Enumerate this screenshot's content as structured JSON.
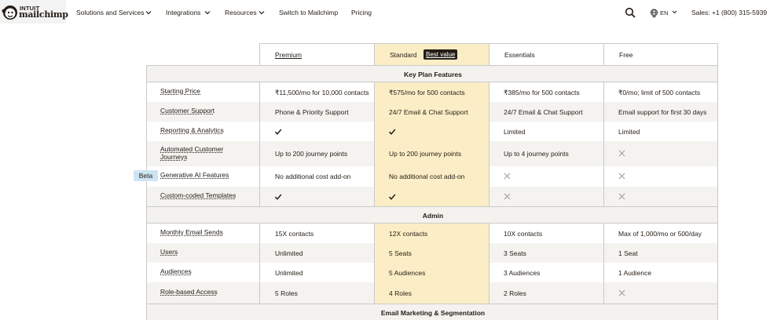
{
  "brand": {
    "intuit": "INTUIT",
    "name": "mailchimp",
    "logo_icon": "freddie-chimp-logo"
  },
  "nav": {
    "items": [
      {
        "label": "Solutions and Services",
        "has_menu": true
      },
      {
        "label": "Integrations",
        "has_menu": true
      },
      {
        "label": "Resources",
        "has_menu": true
      },
      {
        "label": "Switch to Mailchimp",
        "has_menu": false
      },
      {
        "label": "Pricing",
        "has_menu": false
      }
    ],
    "search_icon": "search-icon",
    "language": "EN",
    "language_icon": "globe-icon",
    "sales": "Sales: +1 (800) 315-5939"
  },
  "plans": [
    {
      "name": "Premium",
      "link": true
    },
    {
      "name": "Standard",
      "link": false,
      "badge": "Best value",
      "highlight": true
    },
    {
      "name": "Essentials",
      "link": false
    },
    {
      "name": "Free",
      "link": false
    }
  ],
  "colors": {
    "highlight": "#fbeec6",
    "text": "#241c15",
    "beta": "#cde4f3",
    "section": "#f3f2ee"
  },
  "sections": [
    {
      "title": "Key Plan Features",
      "rows": [
        {
          "feature": "Starting Price",
          "cells": [
            "₹11,500/mo for 10,000 contacts",
            "₹575/mo for 500 contacts",
            "₹385/mo for 500 contacts",
            "₹0/mo; limit of 500 contacts"
          ]
        },
        {
          "feature": "Customer Support",
          "cells": [
            "Phone & Priority Support",
            "24/7 Email & Chat Support",
            "24/7 Email & Chat Support",
            "Email support for first 30 days"
          ]
        },
        {
          "feature": "Reporting & Analytics",
          "cells": [
            "check",
            "check",
            "Limited",
            "Limited"
          ]
        },
        {
          "feature": "Automated Customer Journeys",
          "cells": [
            "Up to 200 journey points",
            "Up to 200 journey points",
            "Up to 4 journey points",
            "x"
          ]
        },
        {
          "feature": "Generative AI Features",
          "tag": "Beta",
          "cells": [
            "No additional cost add-on",
            "No additional cost add-on",
            "x",
            "x"
          ]
        },
        {
          "feature": "Custom-coded Templates",
          "cells": [
            "check",
            "check",
            "x",
            "x"
          ]
        }
      ]
    },
    {
      "title": "Admin",
      "rows": [
        {
          "feature": "Monthly Email Sends",
          "cells": [
            "15X contacts",
            "12X contacts",
            "10X contacts",
            "Max of 1,000/mo or 500/day"
          ]
        },
        {
          "feature": "Users",
          "cells": [
            "Unlimited",
            "5 Seats",
            "3 Seats",
            "1 Seat"
          ]
        },
        {
          "feature": "Audiences",
          "cells": [
            "Unlimited",
            "5 Audiences",
            "3 Audiences",
            "1 Audience"
          ]
        },
        {
          "feature": "Role-based Access",
          "cells": [
            "5 Roles",
            "4 Roles",
            "2 Roles",
            "x"
          ]
        }
      ]
    },
    {
      "title": "Email Marketing & Segmentation",
      "rows": []
    }
  ]
}
